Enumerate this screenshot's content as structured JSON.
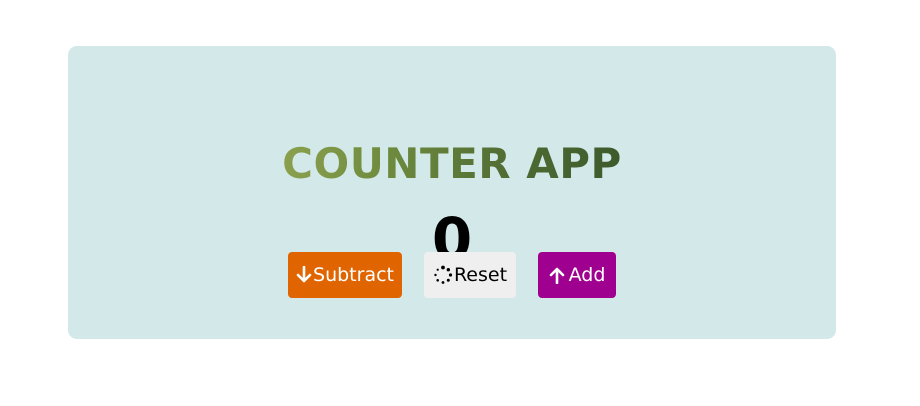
{
  "app": {
    "title": "COUNTER APP",
    "count": "0"
  },
  "buttons": {
    "subtract_label": "Subtract",
    "reset_label": "Reset",
    "add_label": "Add"
  },
  "icons": {
    "subtract": "arrow-down-icon",
    "reset": "spinner-icon",
    "add": "arrow-up-icon"
  },
  "colors": {
    "card_background": "#d3e9e9",
    "subtract_button": "#e06500",
    "reset_button": "#efefef",
    "add_button": "#a0008f",
    "count_text": "#000000"
  }
}
